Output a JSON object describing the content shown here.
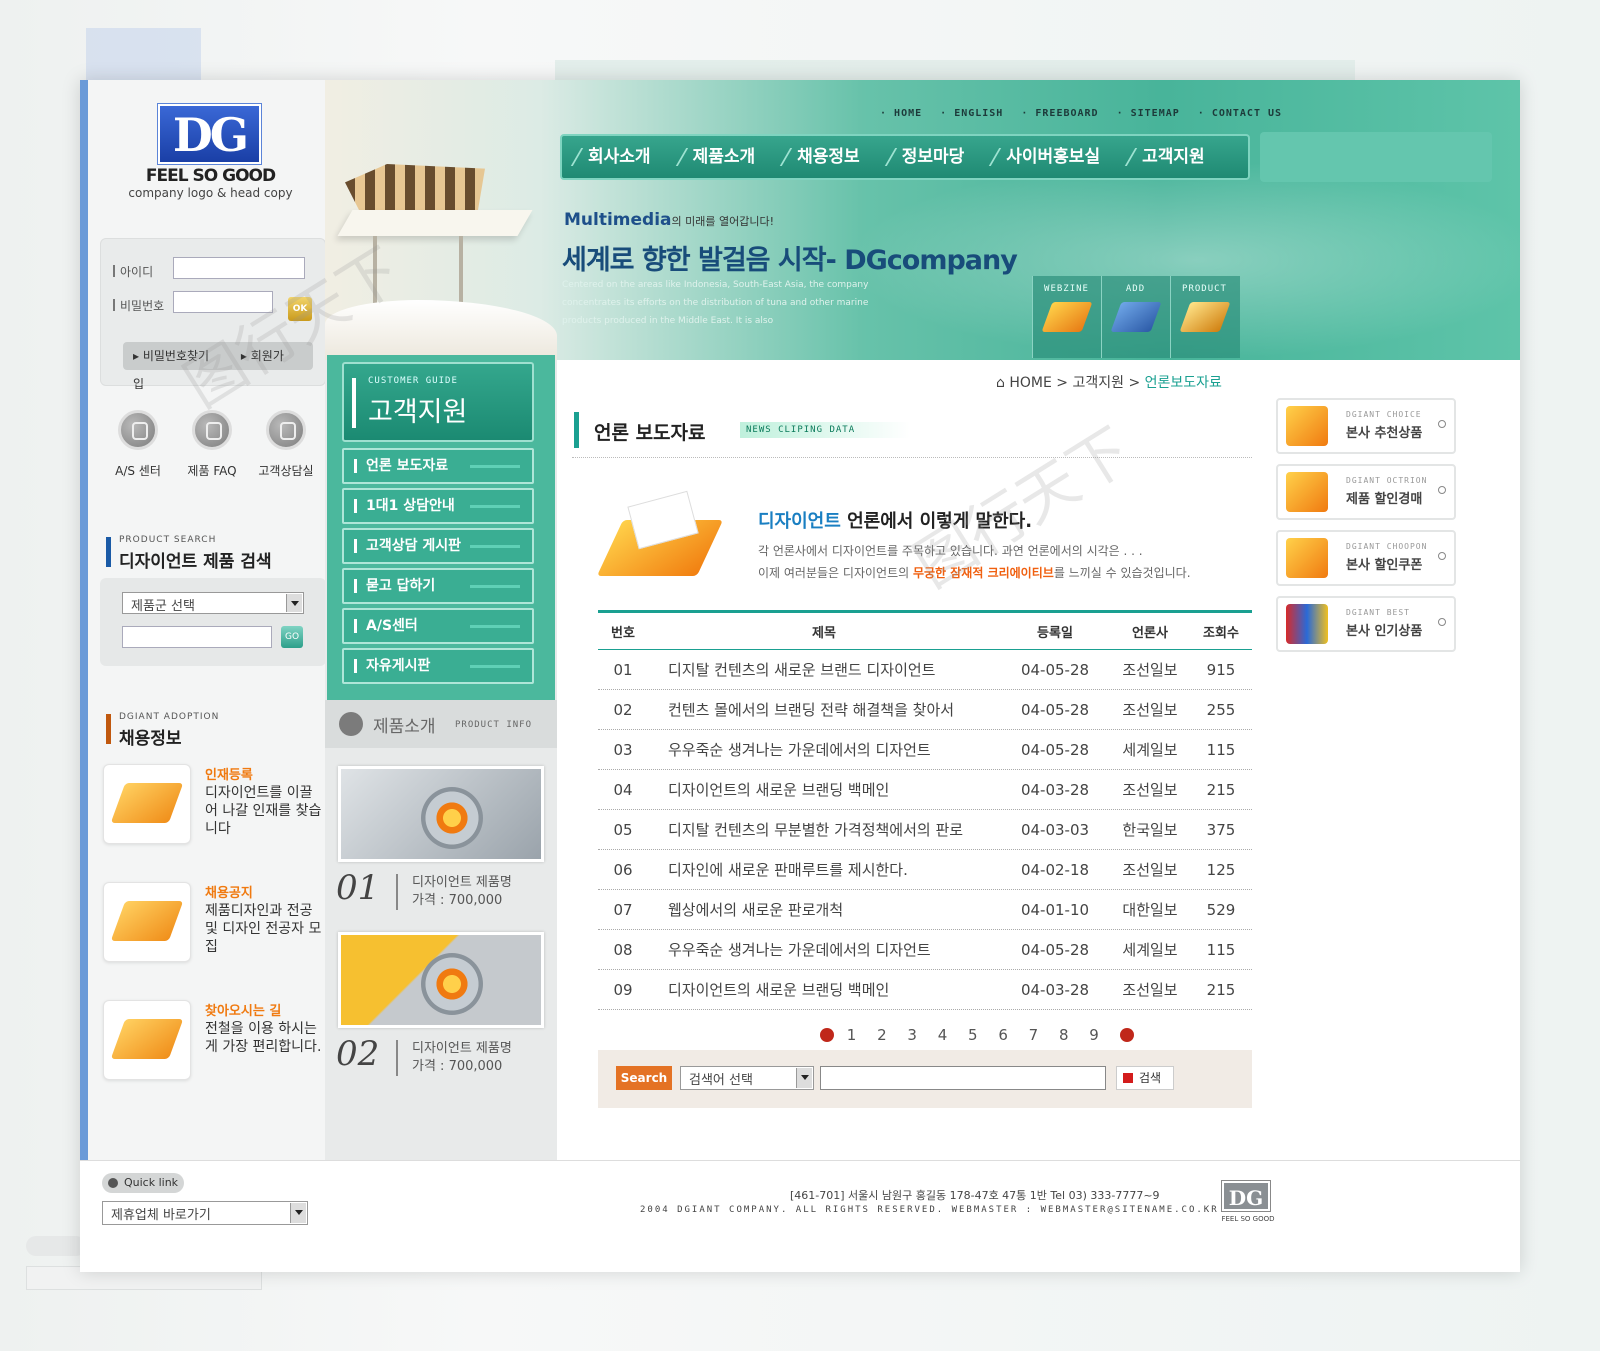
{
  "top_nav": [
    "HOME",
    "ENGLISH",
    "FREEBOARD",
    "SITEMAP",
    "CONTACT US"
  ],
  "brand": {
    "logo": "DG",
    "tagline": "FEEL SO GOOD",
    "subline": "company logo & head copy"
  },
  "login": {
    "id_label": "아이디",
    "pw_label": "비밀번호",
    "ok_label": "OK",
    "find_pw": "비밀번호찾기",
    "join": "회원가입"
  },
  "icon_links": [
    {
      "icon": "wrench-icon",
      "label": "A/S 센터"
    },
    {
      "icon": "people-icon",
      "label": "제품 FAQ"
    },
    {
      "icon": "phone-icon",
      "label": "고객상담실"
    }
  ],
  "product_search": {
    "en": "PRODUCT SEARCH",
    "title": "디자이언트 제품 검색",
    "select": "제품군 선택",
    "go": "GO"
  },
  "adoption": {
    "en": "DGIANT ADOPTION",
    "title": "채용정보"
  },
  "recruit_items": [
    {
      "title": "인재등록",
      "desc": "디자이언트를 이끌어 나갈 인재를 찾습니다"
    },
    {
      "title": "채용공지",
      "desc": "제품디자인과 전공 및 디자인 전공자 모집"
    },
    {
      "title": "찾아오시는 길",
      "desc": "전철을 이용 하시는게 가장 편리합니다."
    }
  ],
  "main_nav": [
    "회사소개",
    "제품소개",
    "채용정보",
    "정보마당",
    "사이버홍보실",
    "고객지원"
  ],
  "hero": {
    "mm_strong": "Multimedia",
    "mm_small": "의 미래를 열어갑니다!",
    "slogan": "세계로 향한 발걸음 시작- DGcompany",
    "desc": "Centered on the areas like Indonesia, South-East Asia, the company concentrates its efforts on the distribution of tuna and other marine products produced in the Middle East. It is also"
  },
  "quick3": [
    {
      "label": "WEBZINE",
      "icon": "books-icon"
    },
    {
      "label": "ADD",
      "icon": "computer-icon"
    },
    {
      "label": "PRODUCT",
      "icon": "product-icon"
    }
  ],
  "customer_guide": {
    "en": "CUSTOMER GUIDE",
    "title": "고객지원"
  },
  "side_menu": [
    "언론 보도자료",
    "1대1 상담안내",
    "고객상담 게시판",
    "묻고 답하기",
    "A/S센터",
    "자유게시판"
  ],
  "product_info": {
    "title": "제품소개",
    "en": "PRODUCT INFO"
  },
  "products": [
    {
      "num": "01",
      "name": "디자이언트 제품명",
      "price": "가격 : 700,000"
    },
    {
      "num": "02",
      "name": "디자이언트 제품명",
      "price": "가격 : 700,000"
    }
  ],
  "breadcrumb": {
    "home": "HOME",
    "sep": ">",
    "mid": "고객지원",
    "current": "언론보도자료"
  },
  "board": {
    "title": "언론 보도자료",
    "en": "NEWS CLIPING DATA",
    "intro_brand": "디자이언트",
    "intro_head": " 언론에서 이렇게 말한다.",
    "intro_line1": "각 언론사에서 디자이언트를 주목하고 있습니다. 과연 언론에서의 시각은 . . .",
    "intro_line2a": "이제 여러분들은 디자이언트의 ",
    "intro_line2b": "무궁한 잠재적 크리에이티브",
    "intro_line2c": "를 느끼실 수 있습것입니다.",
    "headers": [
      "번호",
      "제목",
      "등록일",
      "언론사",
      "조회수"
    ],
    "rows": [
      [
        "01",
        "디지탈 컨텐츠의 새로운 브랜드 디자이언트",
        "04-05-28",
        "조선일보",
        "915"
      ],
      [
        "02",
        "컨텐츠 몰에서의 브랜딩 전략 해결책을 찾아서",
        "04-05-28",
        "조선일보",
        "255"
      ],
      [
        "03",
        "우우죽순 생겨나는 가운데에서의  디자언트",
        "04-05-28",
        "세계일보",
        "115"
      ],
      [
        "04",
        "디자이언트의 새로운 브랜딩 백메인",
        "04-03-28",
        "조선일보",
        "215"
      ],
      [
        "05",
        "디지탈 컨텐츠의 무분별한 가격정책에서의 판로",
        "04-03-03",
        "한국일보",
        "375"
      ],
      [
        "06",
        "디자인에 새로운 판매루트를 제시한다.",
        "04-02-18",
        "조선일보",
        "125"
      ],
      [
        "07",
        "웹상에서의 새로운 판로개척",
        "04-01-10",
        "대한일보",
        "529"
      ],
      [
        "08",
        "우우죽순 생겨나는 가운데에서의  디자언트",
        "04-05-28",
        "세계일보",
        "115"
      ],
      [
        "09",
        "디자이언트의 새로운 브랜딩 백메인",
        "04-03-28",
        "조선일보",
        "215"
      ]
    ],
    "pages": "1 2 3 4 5 6 7 8 9",
    "search_btn": "Search",
    "search_select": "검색어 선택",
    "search_go": "검색"
  },
  "right_cards": [
    {
      "en": "DGIANT CHOICE",
      "ko": "본사 추천상품"
    },
    {
      "en": "DGIANT OCTRION",
      "ko": "제품 할인경매"
    },
    {
      "en": "DGIANT CHOOPON",
      "ko": "본사 할인쿠폰"
    },
    {
      "en": "DGIANT BEST",
      "ko": "본사 인기상품"
    }
  ],
  "footer": {
    "quick_link": "Quick link",
    "partner_select": "제휴업체 바로가기",
    "address": "[461-701] 서울시 남원구 홍길동 178-47호 47통 1반 Tel 03) 333-7777~9",
    "copyright": "2004 DGIANT COMPANY. ALL RIGHTS RESERVED. WEBMASTER : WEBMASTER@SITENAME.CO.KR",
    "logo": "DG",
    "logo_sub": "FEEL SO GOOD"
  },
  "colors": {
    "accent": "#1aa091",
    "brand_blue": "#1a3fa6",
    "orange": "#f07a10"
  }
}
